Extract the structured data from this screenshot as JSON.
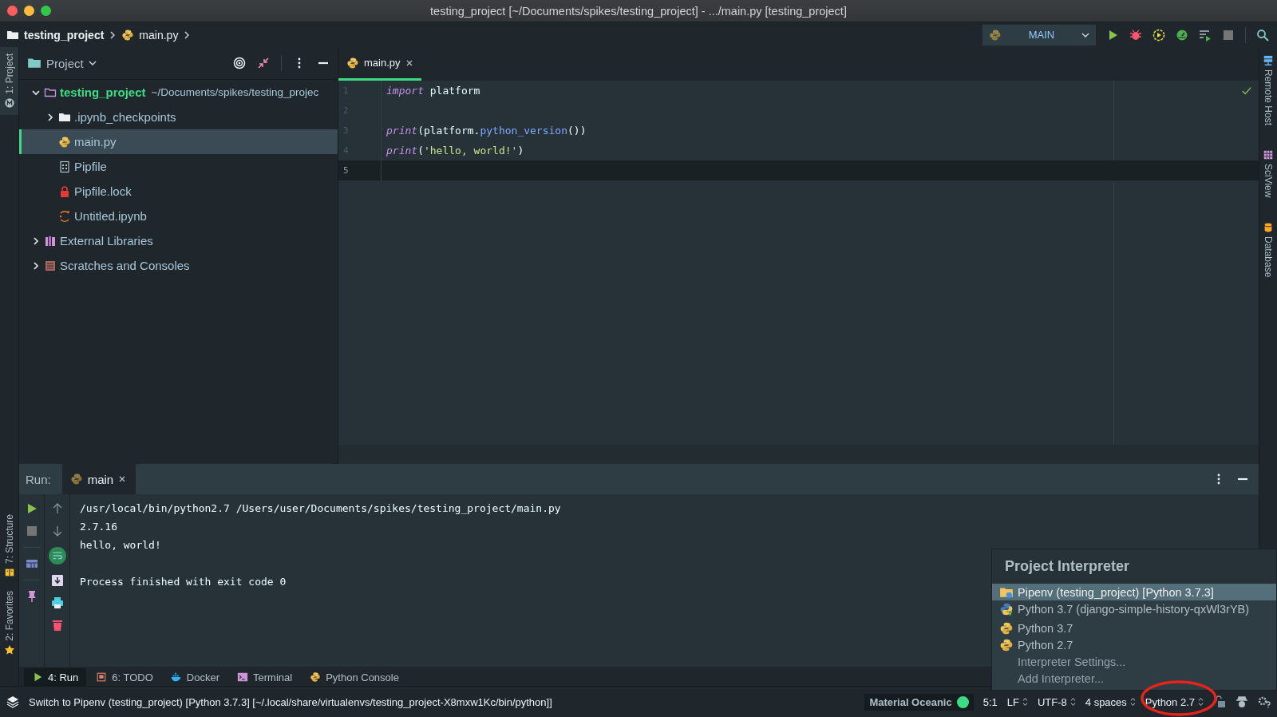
{
  "window": {
    "title": "testing_project [~/Documents/spikes/testing_project] - .../main.py [testing_project]"
  },
  "breadcrumb": [
    {
      "label": "testing_project",
      "kind": "folder"
    },
    {
      "label": "main.py",
      "kind": "python"
    }
  ],
  "run_toolbar": {
    "configuration": "MAIN"
  },
  "left_stripe": [
    {
      "label": "1: Project",
      "kind": "material",
      "selected": true
    },
    {
      "label": "7: Structure",
      "kind": "structure",
      "selected": false
    },
    {
      "label": "2: Favorites",
      "kind": "star",
      "selected": false
    }
  ],
  "right_stripe": [
    {
      "label": "Remote Host",
      "kind": "server"
    },
    {
      "label": "SciView",
      "kind": "grid"
    },
    {
      "label": "Database",
      "kind": "database"
    }
  ],
  "project": {
    "title": "Project",
    "tree": [
      {
        "label": "testing_project",
        "path": "~/Documents/spikes/testing_projec",
        "kind": "folder-outline",
        "expanded": true,
        "selected": false,
        "children": [
          {
            "label": ".ipynb_checkpoints",
            "kind": "folder",
            "expanded": false,
            "selected": false
          },
          {
            "label": "main.py",
            "kind": "python",
            "selected": true
          },
          {
            "label": "Pipfile",
            "kind": "pipfile",
            "selected": false
          },
          {
            "label": "Pipfile.lock",
            "kind": "lock",
            "selected": false
          },
          {
            "label": "Untitled.ipynb",
            "kind": "notebook",
            "selected": false
          }
        ]
      },
      {
        "label": "External Libraries",
        "kind": "library",
        "expanded": false,
        "selected": false
      },
      {
        "label": "Scratches and Consoles",
        "kind": "scratches",
        "expanded": false,
        "selected": false
      }
    ]
  },
  "editor": {
    "tabs": [
      {
        "label": "main.py",
        "selected": true
      }
    ],
    "lines": [
      {
        "number": "1",
        "current": false,
        "tokens": [
          {
            "kind": "keyword",
            "text": "import"
          },
          {
            "kind": "plain",
            "text": " platform"
          }
        ]
      },
      {
        "number": "2",
        "current": false
      },
      {
        "number": "3",
        "current": false,
        "tokens": [
          {
            "kind": "keyword",
            "text": "print"
          },
          {
            "kind": "plain",
            "text": "(platform."
          },
          {
            "kind": "function",
            "text": "python_version"
          },
          {
            "kind": "plain",
            "text": "())"
          }
        ]
      },
      {
        "number": "4",
        "current": false,
        "tokens": [
          {
            "kind": "keyword",
            "text": "print"
          },
          {
            "kind": "plain",
            "text": "("
          },
          {
            "kind": "string",
            "text": "'hello, world!'"
          },
          {
            "kind": "plain",
            "text": ")"
          }
        ]
      },
      {
        "number": "5",
        "current": true
      }
    ]
  },
  "run": {
    "label": "Run:",
    "tabs": [
      {
        "label": "main",
        "selected": true
      }
    ],
    "output": [
      [
        "/usr/local/bin/python2.7 /Users/user/Documents/spikes/testing_project/main.py",
        "2.7.16",
        "hello, world!"
      ],
      [
        "Process finished with exit code 0"
      ]
    ]
  },
  "tool_tabs": [
    {
      "label": "4: Run",
      "kind": "play",
      "selected": true
    },
    {
      "label": "6: TODO",
      "kind": "todo",
      "selected": false
    },
    {
      "label": "Docker",
      "kind": "docker",
      "selected": false
    },
    {
      "label": "Terminal",
      "kind": "terminal",
      "selected": false
    },
    {
      "label": "Python Console",
      "kind": "console",
      "selected": false
    }
  ],
  "status_bar": {
    "message": "Switch to Pipenv (testing_project) [Python 3.7.3] [~/.local/share/virtualenvs/testing_project-X8mxw1Kc/bin/python]]",
    "theme": "Material Oceanic",
    "items": [
      {
        "label": "5:1",
        "kind": "text"
      },
      {
        "label": "LF",
        "kind": "choice"
      },
      {
        "label": "UTF-8",
        "kind": "choice"
      },
      {
        "label": "4 spaces",
        "kind": "choice"
      },
      {
        "label": "Python 2.7",
        "kind": "choice"
      }
    ]
  },
  "interpreter_popup": {
    "title": "Project Interpreter",
    "interpreters": [
      {
        "label": "Pipenv (testing_project) [Python 3.7.3]",
        "kind": "pipenv",
        "selected": true
      },
      {
        "label": "Python 3.7 (django-simple-history-qxWl3rYB)",
        "kind": "venv",
        "selected": false
      },
      {
        "label": "Python 3.7",
        "kind": "python",
        "selected": false
      },
      {
        "label": "Python 2.7",
        "kind": "python",
        "selected": false
      }
    ],
    "actions": [
      "Interpreter Settings...",
      "Add Interpreter..."
    ]
  }
}
